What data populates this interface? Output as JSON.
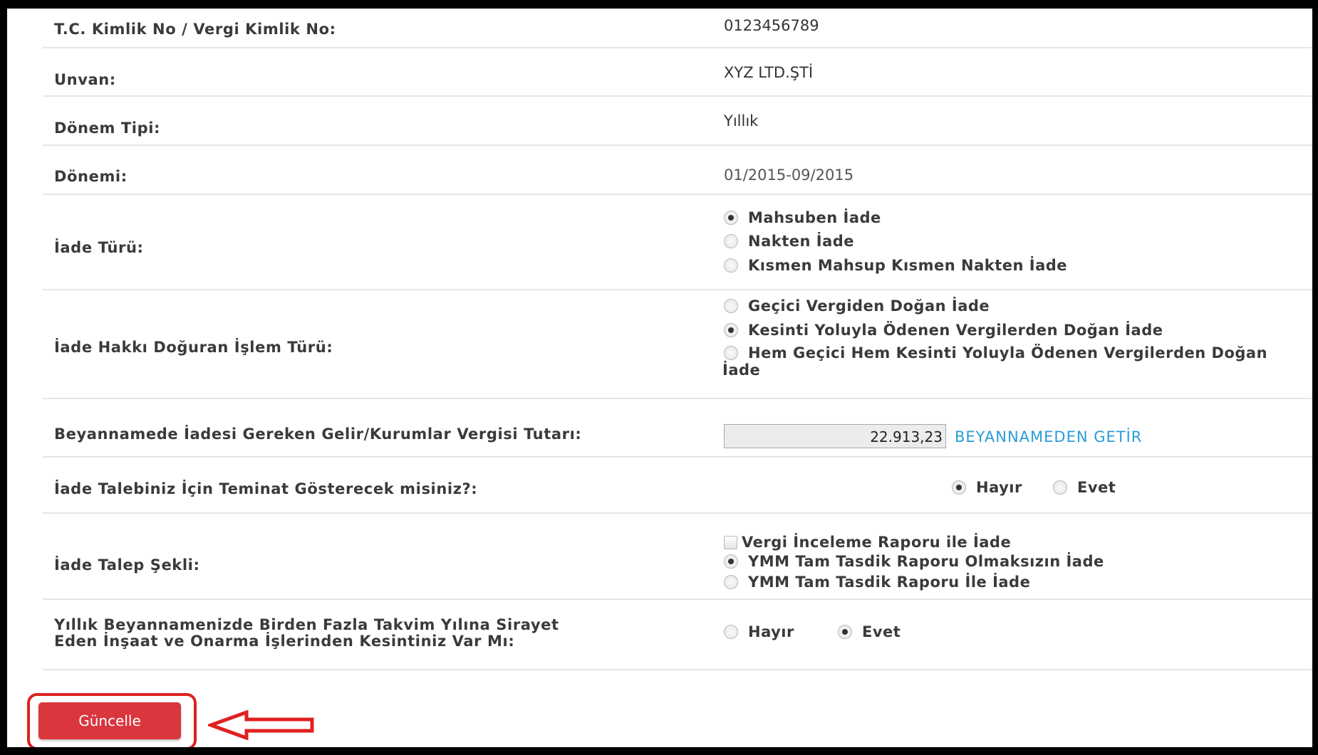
{
  "form": {
    "tc_label": "T.C. Kimlik No / Vergi Kimlik No:",
    "tc_value": "0123456789",
    "unvan_label": "Unvan:",
    "unvan_value": "XYZ LTD.ŞTİ",
    "donem_tipi_label": "Dönem Tipi:",
    "donem_tipi_value": "Yıllık",
    "donemi_label": "Dönemi:",
    "donemi_value": "01/2015-09/2015",
    "iade_turu_label": "İade Türü:",
    "iade_turu_options": [
      {
        "label": "Mahsuben İade",
        "checked": true
      },
      {
        "label": "Nakten İade",
        "checked": false
      },
      {
        "label": "Kısmen Mahsup Kısmen Nakten İade",
        "checked": false
      }
    ],
    "islem_turu_label": "İade Hakkı Doğuran İşlem Türü:",
    "islem_turu_options": [
      {
        "label": "Geçici Vergiden Doğan İade",
        "checked": false
      },
      {
        "label": "Kesinti Yoluyla Ödenen Vergilerden Doğan İade",
        "checked": true
      },
      {
        "label": "Hem Geçici Hem Kesinti Yoluyla Ödenen Vergilerden Doğan",
        "checked": false
      }
    ],
    "islem_turu_option3_wrap": "İade",
    "tutar_label": "Beyannamede İadesi Gereken Gelir/Kurumlar Vergisi Tutarı:",
    "tutar_value": "22.913,23",
    "beyannameden_getir": "BEYANNAMEDEN GETİR",
    "teminat_label": "İade Talebiniz İçin Teminat Gösterecek misiniz?:",
    "teminat_options": [
      {
        "label": "Hayır",
        "checked": true
      },
      {
        "label": "Evet",
        "checked": false
      }
    ],
    "talep_sekli_label": "İade Talep Şekli:",
    "talep_sekli_checkbox": "Vergi İnceleme Raporu ile İade",
    "talep_sekli_options": [
      {
        "label": "YMM Tam Tasdik Raporu Olmaksızın İade",
        "checked": true
      },
      {
        "label": "YMM Tam Tasdik Raporu İle İade",
        "checked": false
      }
    ],
    "insaat_label_line1": "Yıllık Beyannamenizde Birden Fazla Takvim Yılına Sirayet",
    "insaat_label_line2": "Eden İnşaat ve Onarma İşlerinden Kesintiniz Var Mı:",
    "insaat_options": [
      {
        "label": "Hayır",
        "checked": false
      },
      {
        "label": "Evet",
        "checked": true
      }
    ],
    "update_button": "Güncelle"
  },
  "colors": {
    "button": "#d9363e",
    "highlight": "#e02020",
    "link": "#2a9cd8"
  }
}
